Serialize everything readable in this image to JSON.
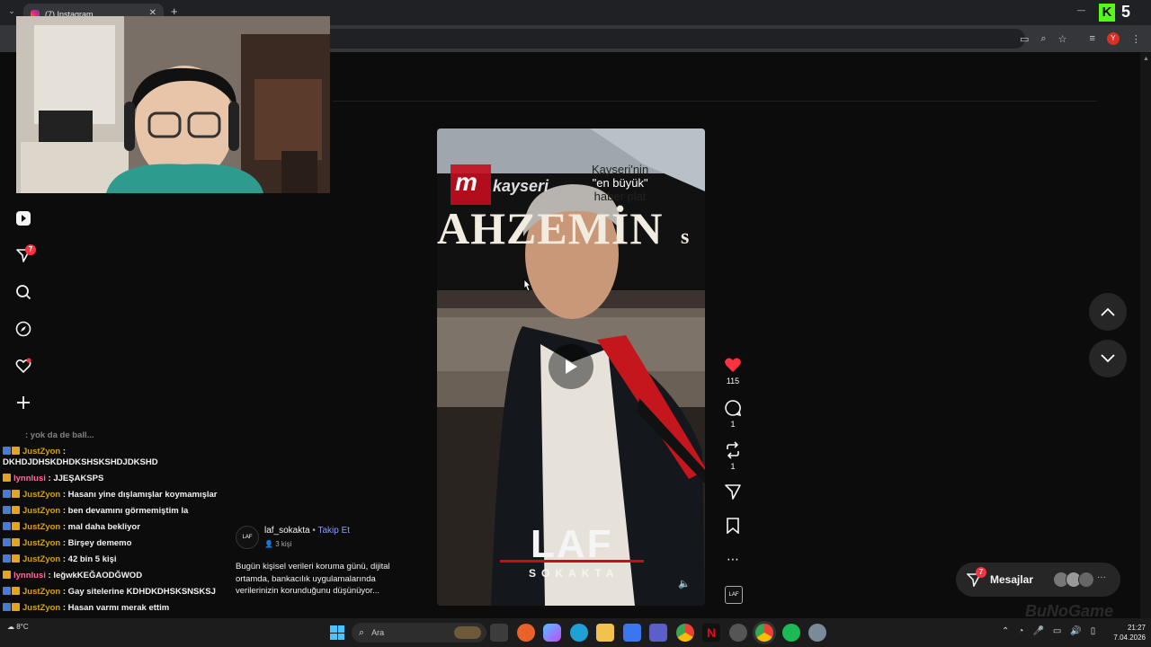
{
  "browser": {
    "tab_title": "(7) Instagram",
    "new_tab": "+",
    "minimize": "—",
    "right_logo": "5",
    "profile_letter": "Y"
  },
  "sidebar": {
    "notifications_badge": "7"
  },
  "video": {
    "sign_text": "AHZEMİN",
    "sign_tail": "s",
    "brand_top": "kayseri",
    "tagline_1": "Kayseri'nin",
    "tagline_2": "\"en büyük\"",
    "tagline_3": "haber plat",
    "logo_big": "LAF",
    "logo_small": "SOKAKTA"
  },
  "actions": {
    "likes": "115",
    "comments": "1",
    "reposts": "1"
  },
  "post": {
    "username": "laf_sokakta",
    "follow": "Takip Et",
    "separator": "•",
    "viewers": "3 kişi",
    "caption": "Bugün kişisel verileri koruma günü, dijital ortamda, bankacılık uygulamalarında verilerinizin korunduğunu düşünüyor..."
  },
  "messages": {
    "label": "Mesajlar",
    "badge": "7",
    "more": "···"
  },
  "chat": [
    {
      "user": "",
      "text": ": yok da de ball..."
    },
    {
      "user": "JustZyon",
      "text": " : DKHDJDHSKDHDKSHSKSHDJDKSHD",
      "cls": "u"
    },
    {
      "user": "lynnlusi",
      "text": " : JJEŞAKSPS",
      "cls": "u2"
    },
    {
      "user": "JustZyon",
      "text": " : Hasanı yine dışlamışlar koymamışlar",
      "cls": "u"
    },
    {
      "user": "JustZyon",
      "text": " : ben devamını görmemiştim la",
      "cls": "u"
    },
    {
      "user": "JustZyon",
      "text": " : mal daha bekliyor",
      "cls": "u"
    },
    {
      "user": "JustZyon",
      "text": " : Birşey dememo",
      "cls": "u"
    },
    {
      "user": "JustZyon",
      "text": " : 42 bin 5 kişi",
      "cls": "u"
    },
    {
      "user": "lynnlusi",
      "text": " : leğwkKEĞAODĞWOD",
      "cls": "u2"
    },
    {
      "user": "JustZyon",
      "text": " : Gay sitelerine KDHDKDHSKSNSKSJ",
      "cls": "u"
    },
    {
      "user": "JustZyon",
      "text": " : Hasan varmı merak ettim",
      "cls": "u"
    }
  ],
  "taskbar": {
    "search": "Ara",
    "time": "21:27",
    "date": "7.04.2026",
    "weather": "8°C"
  },
  "watermark": "BuNoGame",
  "colors": {
    "accent_blue": "#8c9bff",
    "like_red": "#ff3040",
    "badge_red": "#ff3040",
    "chat_user": "#d4a017",
    "chat_user2": "#ff6a9a"
  }
}
